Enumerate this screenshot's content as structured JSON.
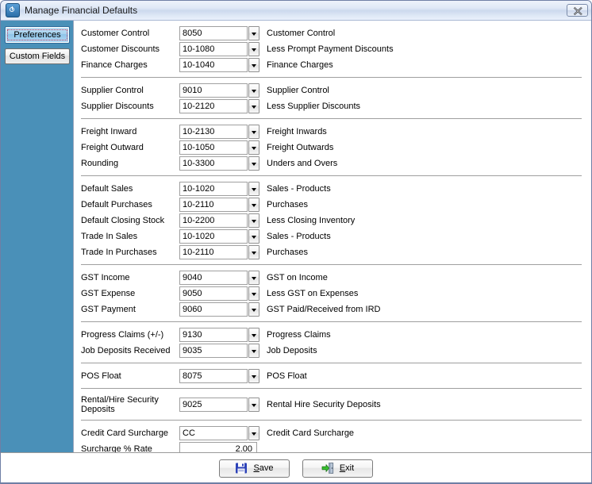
{
  "window": {
    "title": "Manage Financial Defaults",
    "app_icon": "power-icon",
    "close_label": "close-icon"
  },
  "sidebar": {
    "items": [
      {
        "label": "Preferences",
        "selected": true
      },
      {
        "label": "Custom Fields",
        "selected": false
      }
    ]
  },
  "colors": {
    "sidebar_bg": "#4a90b8",
    "titlebar_top": "#eef3fb",
    "titlebar_bottom": "#eaf1fb",
    "selected_tab": "#a7d2ef",
    "focus_outline": "#c4486a",
    "separator": "#9f9f9f",
    "field_border": "#a0a0a0"
  },
  "groups": [
    {
      "name": "customer",
      "rows": [
        {
          "label": "Customer Control",
          "value": "8050",
          "desc": "Customer Control",
          "dropdown": true
        },
        {
          "label": "Customer Discounts",
          "value": "10-1080",
          "desc": "Less Prompt Payment Discounts",
          "dropdown": true
        },
        {
          "label": "Finance Charges",
          "value": "10-1040",
          "desc": "Finance Charges",
          "dropdown": true
        }
      ]
    },
    {
      "name": "supplier",
      "rows": [
        {
          "label": "Supplier Control",
          "value": "9010",
          "desc": "Supplier Control",
          "dropdown": true
        },
        {
          "label": "Supplier Discounts",
          "value": "10-2120",
          "desc": "Less Supplier Discounts",
          "dropdown": true
        }
      ]
    },
    {
      "name": "freight",
      "rows": [
        {
          "label": "Freight Inward",
          "value": "10-2130",
          "desc": "Freight Inwards",
          "dropdown": true
        },
        {
          "label": "Freight Outward",
          "value": "10-1050",
          "desc": "Freight Outwards",
          "dropdown": true
        },
        {
          "label": "Rounding",
          "value": "10-3300",
          "desc": "Unders and Overs",
          "dropdown": true
        }
      ]
    },
    {
      "name": "defaults",
      "rows": [
        {
          "label": "Default Sales",
          "value": "10-1020",
          "desc": "Sales - Products",
          "dropdown": true
        },
        {
          "label": "Default Purchases",
          "value": "10-2110",
          "desc": "Purchases",
          "dropdown": true
        },
        {
          "label": "Default Closing Stock",
          "value": "10-2200",
          "desc": "Less Closing Inventory",
          "dropdown": true
        },
        {
          "label": "Trade In Sales",
          "value": "10-1020",
          "desc": "Sales - Products",
          "dropdown": true
        },
        {
          "label": "Trade In Purchases",
          "value": "10-2110",
          "desc": "Purchases",
          "dropdown": true
        }
      ]
    },
    {
      "name": "gst",
      "rows": [
        {
          "label": "GST Income",
          "value": "9040",
          "desc": "GST on Income",
          "dropdown": true
        },
        {
          "label": "GST Expense",
          "value": "9050",
          "desc": "Less GST on Expenses",
          "dropdown": true
        },
        {
          "label": "GST Payment",
          "value": "9060",
          "desc": "GST Paid/Received from IRD",
          "dropdown": true
        }
      ]
    },
    {
      "name": "progress",
      "rows": [
        {
          "label": "Progress Claims (+/-)",
          "value": "9130",
          "desc": "Progress Claims",
          "dropdown": true
        },
        {
          "label": "Job Deposits Received",
          "value": "9035",
          "desc": "Job Deposits",
          "dropdown": true
        }
      ]
    },
    {
      "name": "pos",
      "rows": [
        {
          "label": "POS Float",
          "value": "8075",
          "desc": "POS Float",
          "dropdown": true
        }
      ]
    },
    {
      "name": "rental",
      "rows": [
        {
          "label": "Rental/Hire Security Deposits",
          "value": "9025",
          "desc": "Rental Hire Security Deposits",
          "dropdown": true,
          "two_line": true
        }
      ]
    },
    {
      "name": "surcharge",
      "rows": [
        {
          "label": "Credit Card Surcharge",
          "value": "CC",
          "desc": "Credit Card Surcharge",
          "dropdown": true
        },
        {
          "label": "Surcharge % Rate",
          "value": "2.00",
          "desc": "",
          "dropdown": false,
          "numeric": true
        }
      ]
    }
  ],
  "footer": {
    "buttons": [
      {
        "label": "Save",
        "accel": "S",
        "icon": "floppy-disk-icon"
      },
      {
        "label": "Exit",
        "accel": "E",
        "icon": "exit-door-icon"
      }
    ]
  }
}
